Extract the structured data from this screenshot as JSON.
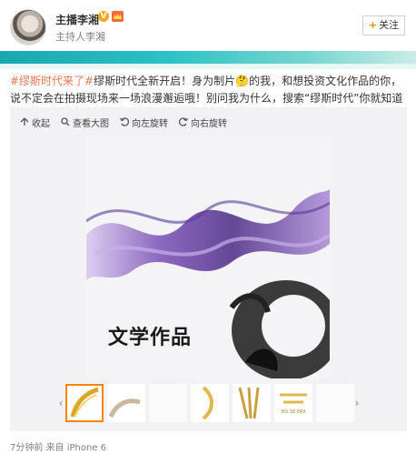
{
  "user": {
    "name": "主播李湘",
    "badge": "V",
    "subtitle": "主持人李湘"
  },
  "follow_button": {
    "label": "关注",
    "plus": "+"
  },
  "post": {
    "topic": "#缪斯时代来了#",
    "text": "缪斯时代全新开启！身为制片🤔的我，和想投资文化作品的你，说不定会在拍摄现场来一场浪漫邂逅哦！别问我为什么，搜索“缪斯时代”你就知道啦！乖~~"
  },
  "toolbar": {
    "collapse": "收起",
    "view_large": "查看大图",
    "rotate_left": "向左旋转",
    "rotate_right": "向右旋转"
  },
  "image": {
    "title": "文学作品"
  },
  "thumbnail_strip": {
    "left_arrow": "‹",
    "right_arrow": "›",
    "caption": "MU SE ERA"
  },
  "footer": {
    "time": "7分钟前",
    "source_prefix": "来自",
    "device": "iPhone 6"
  },
  "colors": {
    "accent": "#ff8200",
    "topic": "#eb7350",
    "banner": "#2bc1c5",
    "purple": "#7a4fb5"
  }
}
